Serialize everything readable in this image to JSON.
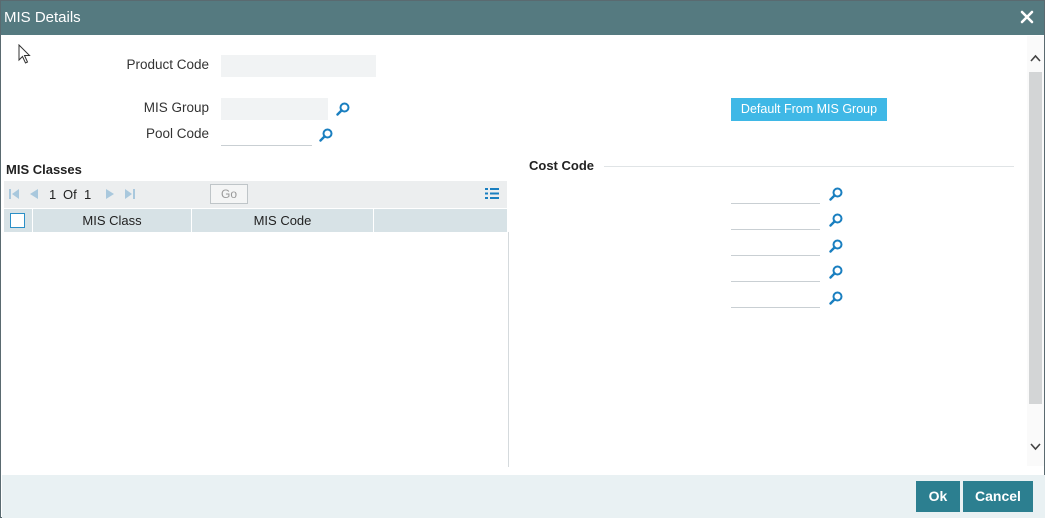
{
  "window": {
    "title": "MIS Details"
  },
  "form": {
    "product_code_label": "Product Code",
    "product_code_value": "",
    "mis_group_label": "MIS Group",
    "mis_group_value": "",
    "pool_code_label": "Pool Code",
    "pool_code_value": "",
    "default_button_label": "Default From MIS Group"
  },
  "mis_classes": {
    "section_title": "MIS Classes",
    "pagination": {
      "current": "1",
      "of_label": "Of",
      "total": "1",
      "go_label": "Go"
    },
    "columns": [
      "MIS Class",
      "MIS Code"
    ],
    "rows": []
  },
  "cost_code": {
    "section_title": "Cost Code",
    "fields": [
      "",
      "",
      "",
      "",
      ""
    ]
  },
  "footer": {
    "ok_label": "Ok",
    "cancel_label": "Cancel"
  },
  "icons": {
    "close": "close-icon",
    "search": "search-icon",
    "first_page": "first-page-icon",
    "prev_page": "prev-page-icon",
    "next_page": "next-page-icon",
    "last_page": "last-page-icon",
    "column_list": "list-icon"
  },
  "colors": {
    "titlebar": "#557a80",
    "accent_button": "#3fb8e6",
    "footer_button": "#2c7f90",
    "search_icon": "#1a7fc0"
  }
}
